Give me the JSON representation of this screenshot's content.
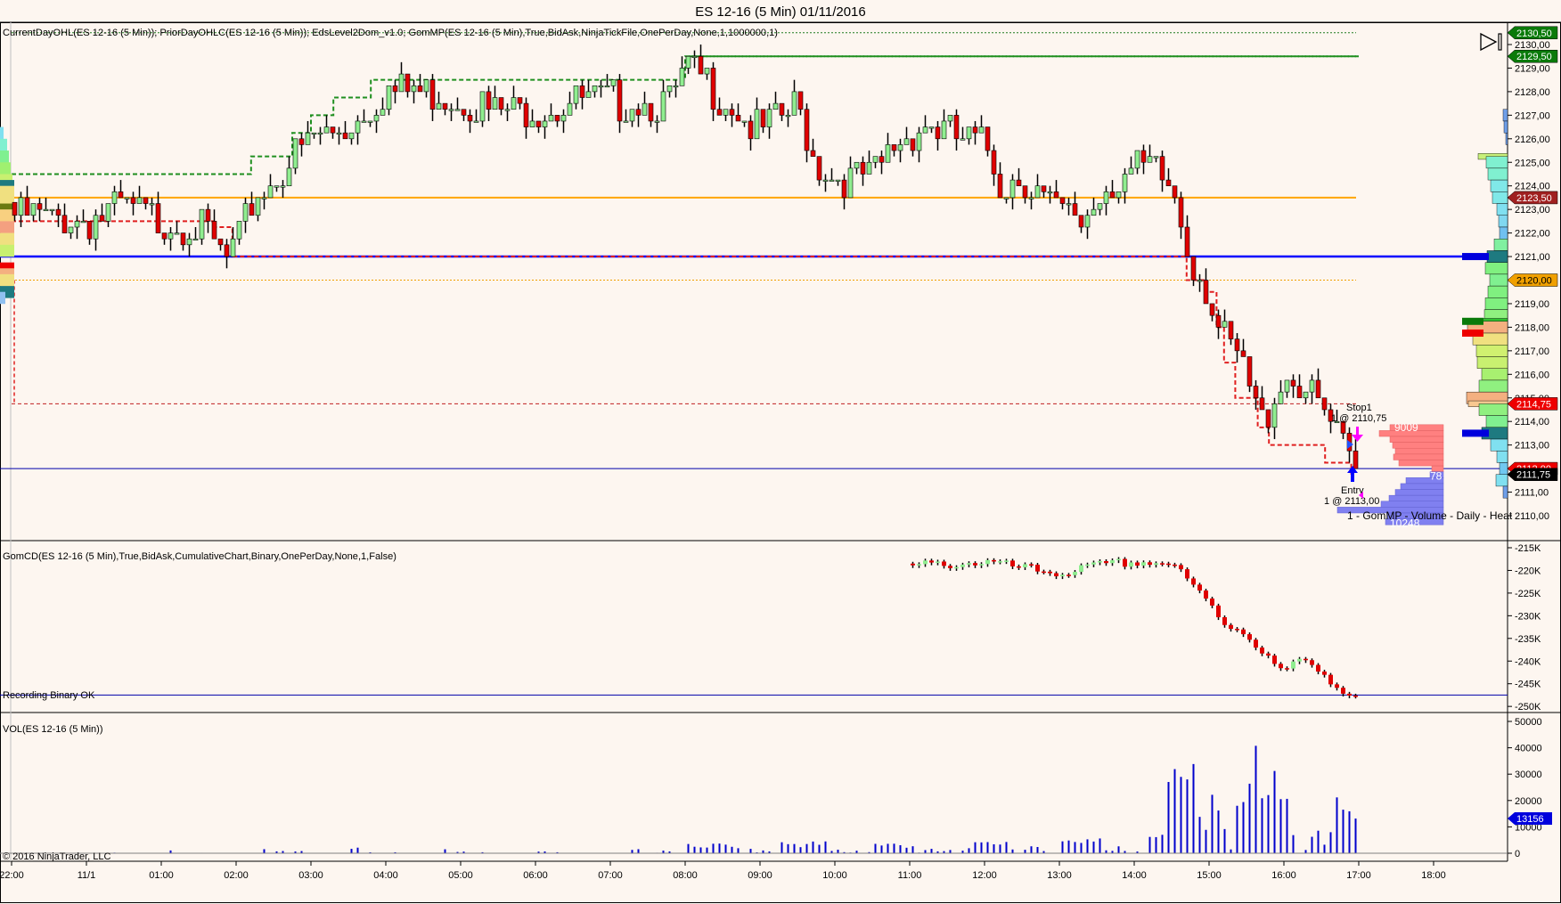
{
  "window": {
    "title": "ES 12-16 (5 Min)  01/11/2016"
  },
  "panels": {
    "price": {
      "label": "CurrentDayOHL(ES 12-16 (5 Min)); PriorDayOHLC(ES 12-16 (5 Min)); EdsLevel2Dom_v1.0; GomMP(ES 12-16 (5 Min),True,BidAsk,NinjaTickFile,OnePerDay,None,1,1000000,1)"
    },
    "delta": {
      "label": "GomCD(ES 12-16 (5 Min),True,BidAsk,CumulativeChart,Binary,OnePerDay,None,1,False)",
      "status": "Recording Binary OK"
    },
    "volume": {
      "label": "VOL(ES 12-16 (5 Min))",
      "copyright": "© 2016 NinjaTrader, LLC"
    }
  },
  "icons": {
    "end_of_chart": "skip-to-end-icon"
  },
  "colors": {
    "up": "#90ee90",
    "down": "#e00000",
    "background": "#fdf6f0",
    "volume": "#0000cc",
    "high_line": "#1f8f1f",
    "low_line": "#e02020",
    "open_line": "#ffa500",
    "level_line": "#0000ff"
  },
  "price_axis": {
    "ticks": [
      "2130,00",
      "2129,00",
      "2128,00",
      "2127,00",
      "2126,00",
      "2125,00",
      "2124,00",
      "2123,00",
      "2122,00",
      "2121,00",
      "2120,00",
      "2119,00",
      "2118,00",
      "2117,00",
      "2116,00",
      "2115,00",
      "2114,00",
      "2113,00",
      "2112,00",
      "2111,00",
      "2110,00"
    ],
    "tick_values": [
      2130,
      2129,
      2128,
      2127,
      2126,
      2125,
      2124,
      2123,
      2122,
      2121,
      2120,
      2119,
      2118,
      2117,
      2116,
      2115,
      2114,
      2113,
      2112,
      2111,
      2110
    ],
    "flags": [
      {
        "label": "2130,50",
        "price": 2130.5,
        "color": "#0a7a0a"
      },
      {
        "label": "2129,50",
        "price": 2129.5,
        "color": "#0a7a0a"
      },
      {
        "label": "2123,50",
        "price": 2123.5,
        "color": "#a02020"
      },
      {
        "label": "2120,00",
        "price": 2120.0,
        "color": "#f0a000",
        "text_color": "#000"
      },
      {
        "label": "2114,75",
        "price": 2114.75,
        "color": "#ee0000"
      },
      {
        "label": "2112,00",
        "price": 2112.0,
        "color": "#ee0000"
      },
      {
        "label": "2111,75",
        "price": 2111.75,
        "color": "#000000"
      }
    ]
  },
  "delta_axis": {
    "ticks": [
      "-215K",
      "-220K",
      "-225K",
      "-230K",
      "-235K",
      "-240K",
      "-245K",
      "-250K"
    ],
    "tick_values": [
      -215,
      -220,
      -225,
      -230,
      -235,
      -240,
      -245,
      -250
    ]
  },
  "volume_axis": {
    "ticks": [
      "50000",
      "40000",
      "30000",
      "20000",
      "10000",
      "0"
    ],
    "tick_values": [
      50000,
      40000,
      30000,
      20000,
      10000,
      0
    ],
    "last_label": "13156",
    "last_value": 13156
  },
  "time_axis": {
    "labels": [
      "22:00",
      "11/1",
      "01:00",
      "02:00",
      "03:00",
      "04:00",
      "05:00",
      "06:00",
      "07:00",
      "08:00",
      "09:00",
      "10:00",
      "11:00",
      "12:00",
      "13:00",
      "14:00",
      "15:00",
      "16:00",
      "17:00",
      "18:00"
    ]
  },
  "levels": {
    "prior_high": 2130.5,
    "current_high": 2129.5,
    "open": 2123.5,
    "level_2121": 2121.0,
    "prior_mid": 2120.0,
    "prior_low": 2114.75,
    "last": 2112.0
  },
  "trade": {
    "stop_label": "Stop1",
    "stop_detail": "1 @ 2110,75",
    "stop_price": 2110.75,
    "entry_label": "Entry",
    "entry_detail": "1 @ 2113,00",
    "entry_price": 2113.0
  },
  "session_profile": {
    "label": "1 - GomMP - Volume - Daily - Heat",
    "top_value": "9009",
    "mid_value": "78",
    "bottom_value": "10248",
    "ask_rows": [
      [
        2113.75,
        60
      ],
      [
        2113.5,
        72
      ],
      [
        2113.25,
        60
      ],
      [
        2113.0,
        57
      ],
      [
        2112.75,
        54
      ],
      [
        2112.5,
        56
      ],
      [
        2112.25,
        50
      ],
      [
        2112.0,
        13
      ]
    ],
    "bid_rows": [
      [
        2111.75,
        15
      ],
      [
        2111.5,
        42
      ],
      [
        2111.25,
        48
      ],
      [
        2111.0,
        54
      ],
      [
        2110.75,
        61
      ],
      [
        2110.5,
        70
      ],
      [
        2110.25,
        119
      ],
      [
        2110.0,
        63
      ],
      [
        2109.75,
        65
      ]
    ]
  },
  "chart_data": {
    "type": "candlestick",
    "price_anchors": [
      [
        -1,
        2123.3
      ],
      [
        -0.5,
        2123
      ],
      [
        0,
        2123
      ],
      [
        0.5,
        2123.5
      ],
      [
        1,
        2123
      ],
      [
        1.5,
        2122.8
      ],
      [
        1.9,
        2121.2
      ],
      [
        2.1,
        2122.5
      ],
      [
        2.25,
        2124
      ],
      [
        2.6,
        2125
      ],
      [
        3,
        2126.5
      ],
      [
        3.4,
        2126.8
      ],
      [
        4,
        2128.5
      ],
      [
        4.6,
        2128.5
      ],
      [
        5,
        2128.2
      ],
      [
        5.5,
        2127.5
      ],
      [
        6,
        2127.8
      ],
      [
        7,
        2128.1
      ],
      [
        7.8,
        2128
      ],
      [
        8.05,
        2129.3
      ],
      [
        8.5,
        2128.3
      ],
      [
        9,
        2126.7
      ],
      [
        9.5,
        2127.8
      ],
      [
        9.75,
        2125.5
      ],
      [
        10,
        2124.8
      ],
      [
        10.5,
        2124.8
      ],
      [
        10.85,
        2126.4
      ],
      [
        11.2,
        2127.2
      ],
      [
        11.6,
        2126.5
      ],
      [
        12,
        2126.2
      ],
      [
        12.25,
        2124.4
      ],
      [
        12.5,
        2125
      ],
      [
        12.85,
        2123.6
      ],
      [
        13,
        2123.3
      ],
      [
        13.3,
        2123
      ],
      [
        13.6,
        2124.4
      ],
      [
        13.9,
        2125
      ],
      [
        14.3,
        2125
      ],
      [
        14.55,
        2124
      ],
      [
        14.75,
        2121.5
      ],
      [
        15,
        2120
      ],
      [
        15.15,
        2118
      ],
      [
        15.4,
        2117
      ],
      [
        15.7,
        2114.3
      ],
      [
        16,
        2116.5
      ],
      [
        16.25,
        2116
      ],
      [
        16.5,
        2114.8
      ],
      [
        16.75,
        2113.5
      ],
      [
        16.95,
        2112.2
      ]
    ],
    "current_high_steps": [
      [
        -1,
        2124.5
      ],
      [
        2.2,
        2124.5
      ],
      [
        2.2,
        2125.25
      ],
      [
        2.75,
        2125.25
      ],
      [
        2.75,
        2126.25
      ],
      [
        3,
        2126.25
      ],
      [
        3,
        2127
      ],
      [
        3.3,
        2127
      ],
      [
        3.3,
        2127.75
      ],
      [
        3.8,
        2127.75
      ],
      [
        3.8,
        2128.5
      ],
      [
        8,
        2128.5
      ],
      [
        8,
        2129.5
      ],
      [
        17,
        2129.5
      ]
    ],
    "current_low_steps": [
      [
        -1,
        2122.5
      ],
      [
        1.7,
        2122.5
      ],
      [
        1.7,
        2122.25
      ],
      [
        1.95,
        2122.25
      ],
      [
        1.95,
        2121
      ],
      [
        14.7,
        2121
      ],
      [
        14.7,
        2120
      ],
      [
        14.95,
        2120
      ],
      [
        14.95,
        2119.5
      ],
      [
        15.1,
        2119.5
      ],
      [
        15.1,
        2118
      ],
      [
        15.2,
        2118
      ],
      [
        15.2,
        2116.5
      ],
      [
        15.35,
        2116.5
      ],
      [
        15.35,
        2115
      ],
      [
        15.65,
        2115
      ],
      [
        15.65,
        2113.75
      ],
      [
        15.8,
        2113.75
      ],
      [
        15.8,
        2113
      ],
      [
        16.55,
        2113
      ],
      [
        16.55,
        2112.25
      ],
      [
        16.9,
        2112.25
      ],
      [
        16.9,
        2111.75
      ]
    ],
    "delta_anchors": [
      [
        11,
        -218.5
      ],
      [
        12,
        -217.5
      ],
      [
        12.5,
        -219
      ],
      [
        13,
        -220
      ],
      [
        13.5,
        -218.5
      ],
      [
        14,
        -217.5
      ],
      [
        14.5,
        -217.8
      ],
      [
        14.75,
        -222.5
      ],
      [
        15,
        -226.5
      ],
      [
        15.2,
        -231
      ],
      [
        15.5,
        -233
      ],
      [
        15.75,
        -238.5
      ],
      [
        16,
        -242
      ],
      [
        16.25,
        -239
      ],
      [
        16.5,
        -241
      ],
      [
        16.75,
        -246
      ],
      [
        16.95,
        -247.5
      ]
    ],
    "volume_anchors": [
      [
        -1,
        2000
      ],
      [
        0,
        1500
      ],
      [
        1,
        800
      ],
      [
        2,
        1500
      ],
      [
        3,
        1800
      ],
      [
        4,
        1500
      ],
      [
        7,
        800
      ],
      [
        8,
        2500
      ],
      [
        9,
        3500
      ],
      [
        10,
        3500
      ],
      [
        11,
        3000
      ],
      [
        12,
        3000
      ],
      [
        12.3,
        5000
      ],
      [
        13,
        4000
      ],
      [
        13.5,
        5500
      ],
      [
        14,
        6000
      ],
      [
        14.4,
        8000
      ],
      [
        14.5,
        30000
      ],
      [
        14.8,
        38000
      ],
      [
        15.1,
        44000
      ],
      [
        15.3,
        30000
      ],
      [
        15.6,
        32000
      ],
      [
        16,
        20000
      ],
      [
        16.5,
        15000
      ],
      [
        16.6,
        28000
      ],
      [
        16.9,
        13156
      ]
    ],
    "volume_profile": [
      [
        2127.0,
        5,
        "#6f9fe8"
      ],
      [
        2126.5,
        4,
        "#6f9fe8"
      ],
      [
        2126.0,
        2,
        "#6f9fe8"
      ],
      [
        2125.25,
        33,
        "#c8f07a"
      ],
      [
        2125.0,
        24,
        "#80f0d0"
      ],
      [
        2124.5,
        22,
        "#80f0d0"
      ],
      [
        2124.0,
        19,
        "#80e8e8"
      ],
      [
        2123.5,
        17,
        "#80e8e8"
      ],
      [
        2123.0,
        12,
        "#80e0f0"
      ],
      [
        2122.5,
        10,
        "#80d8f0"
      ],
      [
        2122.0,
        9,
        "#70c0f0"
      ],
      [
        2121.5,
        15,
        "#80f0a0"
      ],
      [
        2121.0,
        23,
        "#1e7a80"
      ],
      [
        2120.5,
        25,
        "#80f080"
      ],
      [
        2120.0,
        20,
        "#80f090"
      ],
      [
        2119.5,
        22,
        "#80f080"
      ],
      [
        2119.0,
        25,
        "#80f080"
      ],
      [
        2118.5,
        26,
        "#90f080"
      ],
      [
        2118.25,
        33,
        "#30c030"
      ],
      [
        2118.0,
        45,
        "#f4b080"
      ],
      [
        2117.5,
        39,
        "#f0e080"
      ],
      [
        2117.0,
        35,
        "#d0f070"
      ],
      [
        2116.5,
        34,
        "#c8f070"
      ],
      [
        2116.0,
        29,
        "#a8f070"
      ],
      [
        2115.5,
        32,
        "#90f080"
      ],
      [
        2115.0,
        46,
        "#f4b080"
      ],
      [
        2114.75,
        44,
        "#f8c890"
      ],
      [
        2114.5,
        32,
        "#90f080"
      ],
      [
        2114.0,
        24,
        "#80f090"
      ],
      [
        2113.5,
        29,
        "#1e7a80"
      ],
      [
        2113.0,
        19,
        "#80e0f0"
      ],
      [
        2112.5,
        12,
        "#80e0f0"
      ],
      [
        2112.0,
        9,
        "#70c8f0"
      ],
      [
        2111.5,
        13,
        "#80e0f0"
      ],
      [
        2111.0,
        5,
        "#6f9fe8"
      ]
    ],
    "profile_markers": [
      [
        2121.0,
        "#0000dd"
      ],
      [
        2113.5,
        "#0000dd"
      ],
      [
        2118.25,
        "#0a7a0a"
      ],
      [
        2117.75,
        "#ee0000"
      ]
    ]
  }
}
